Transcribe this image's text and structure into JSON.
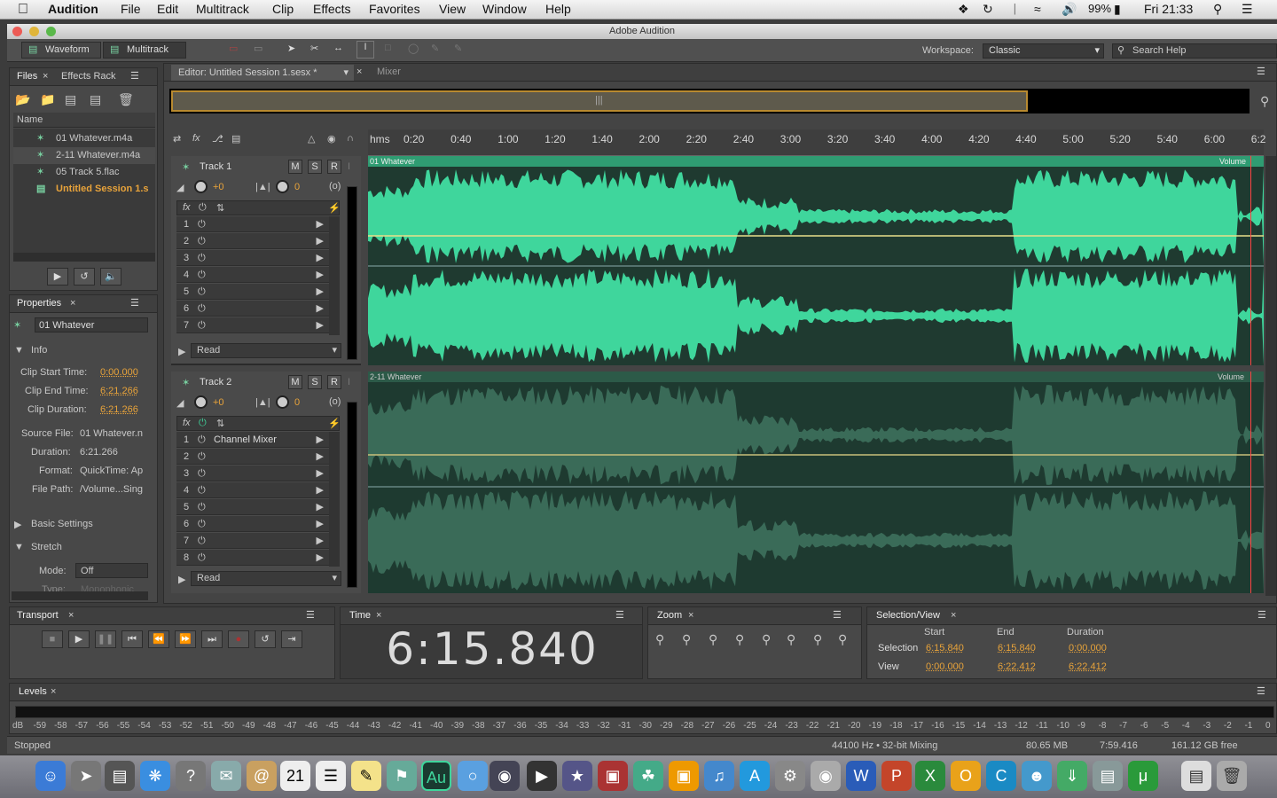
{
  "menubar": {
    "app": "Audition",
    "items": [
      "File",
      "Edit",
      "Multitrack",
      "Clip",
      "Effects",
      "Favorites",
      "View",
      "Window",
      "Help"
    ],
    "battery": "99%",
    "clock": "Fri 21:33"
  },
  "window": {
    "title": "Adobe Audition"
  },
  "toolbar": {
    "waveform": "Waveform",
    "multitrack": "Multitrack",
    "workspace_label": "Workspace:",
    "workspace_value": "Classic",
    "search_placeholder": "Search Help"
  },
  "files_panel": {
    "tab_files": "Files",
    "tab_effects": "Effects Rack",
    "col_name": "Name",
    "items": [
      "01 Whatever.m4a",
      "2-11 Whatever.m4a",
      "05 Track 5.flac",
      "Untitled Session 1.s"
    ]
  },
  "properties": {
    "tab": "Properties",
    "clip_name": "01 Whatever",
    "info_header": "Info",
    "clip_start_label": "Clip Start Time:",
    "clip_start": "0:00.000",
    "clip_end_label": "Clip End Time:",
    "clip_end": "6:21.266",
    "clip_dur_label": "Clip Duration:",
    "clip_dur": "6:21.266",
    "source_file_label": "Source File:",
    "source_file": "01 Whatever.n",
    "duration_label": "Duration:",
    "duration": "6:21.266",
    "format_label": "Format:",
    "format": "QuickTime: Ap",
    "filepath_label": "File Path:",
    "filepath": "/Volume...Sing",
    "basic_settings": "Basic Settings",
    "stretch": "Stretch",
    "mode_label": "Mode:",
    "mode": "Off",
    "type_label": "Type:",
    "type": "Monophonic"
  },
  "editor": {
    "tab": "Editor: Untitled Session 1.sesx *",
    "mixer": "Mixer"
  },
  "ruler": {
    "unit": "hms",
    "ticks": [
      "0:20",
      "0:40",
      "1:00",
      "1:20",
      "1:40",
      "2:00",
      "2:20",
      "2:40",
      "3:00",
      "3:20",
      "3:40",
      "4:00",
      "4:20",
      "4:40",
      "5:00",
      "5:20",
      "5:40",
      "6:00",
      "6:2"
    ]
  },
  "tracks": [
    {
      "name": "Track 1",
      "m": "M",
      "s": "S",
      "r": "R",
      "vol": "+0",
      "pan": "0",
      "clip": "01 Whatever",
      "volume": "Volume",
      "mode": "Read",
      "fx": [
        "1",
        "2",
        "3",
        "4",
        "5",
        "6",
        "7"
      ],
      "fx1": ""
    },
    {
      "name": "Track 2",
      "m": "M",
      "s": "S",
      "r": "R",
      "vol": "+0",
      "pan": "0",
      "clip": "2-11 Whatever",
      "volume": "Volume",
      "mode": "Read",
      "fx": [
        "1",
        "2",
        "3",
        "4",
        "5",
        "6",
        "7",
        "8"
      ],
      "fx1": "Channel Mixer"
    }
  ],
  "transport": {
    "tab": "Transport"
  },
  "time": {
    "tab": "Time",
    "value": "6:15.840"
  },
  "zoom": {
    "tab": "Zoom"
  },
  "selview": {
    "tab": "Selection/View",
    "start": "Start",
    "end": "End",
    "duration": "Duration",
    "selection_label": "Selection",
    "sel_start": "6:15.840",
    "sel_end": "6:15.840",
    "sel_dur": "0:00.000",
    "view_label": "View",
    "view_start": "0:00.000",
    "view_end": "6:22.412",
    "view_dur": "6:22.412"
  },
  "levels": {
    "tab": "Levels",
    "scale": [
      "dB",
      "-59",
      "-58",
      "-57",
      "-56",
      "-55",
      "-54",
      "-53",
      "-52",
      "-51",
      "-50",
      "-49",
      "-48",
      "-47",
      "-46",
      "-45",
      "-44",
      "-43",
      "-42",
      "-41",
      "-40",
      "-39",
      "-38",
      "-37",
      "-36",
      "-35",
      "-34",
      "-33",
      "-32",
      "-31",
      "-30",
      "-29",
      "-28",
      "-27",
      "-26",
      "-25",
      "-24",
      "-23",
      "-22",
      "-21",
      "-20",
      "-19",
      "-18",
      "-17",
      "-16",
      "-15",
      "-14",
      "-13",
      "-12",
      "-11",
      "-10",
      "-9",
      "-8",
      "-7",
      "-6",
      "-5",
      "-4",
      "-3",
      "-2",
      "-1",
      "0"
    ]
  },
  "status": {
    "state": "Stopped",
    "rate": "44100 Hz • 32-bit Mixing",
    "mem": "80.65 MB",
    "time": "7:59.416",
    "free": "161.12 GB free"
  },
  "colors": {
    "wave_selected": "#3fd69c",
    "wave_unselected": "#3a6b58",
    "accent": "#e8a33a"
  }
}
